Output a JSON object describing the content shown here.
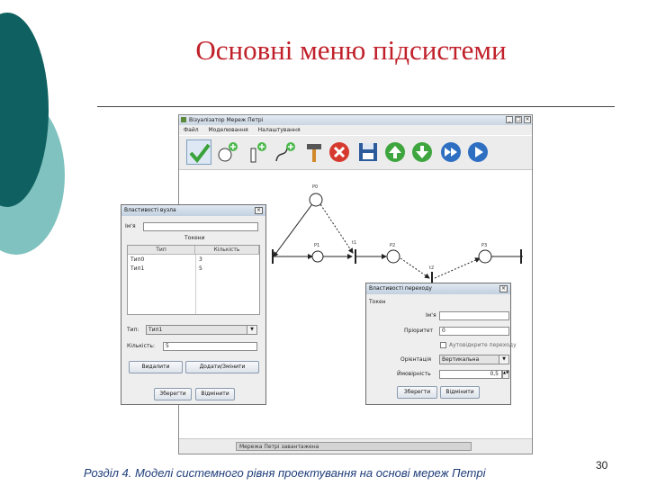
{
  "slide": {
    "title": "Основні меню підсистеми",
    "footer": "Розділ 4. Моделі системного рівня проектування на основі мереж Петрі",
    "page_number": "30",
    "colors": {
      "title": "#c0202a",
      "decor_dark": "#0f6060",
      "decor_light": "#7fc2bf",
      "footer": "#1f3d7a"
    }
  },
  "app": {
    "title": "Візуалізатор Мереж Петрі",
    "menu": [
      "Файл",
      "Моделювання",
      "Налаштування"
    ],
    "toolbar": [
      {
        "name": "select-tool",
        "icon": "checkmark-icon",
        "selected": true
      },
      {
        "name": "add-place",
        "icon": "add-place-icon"
      },
      {
        "name": "add-transition",
        "icon": "add-transition-icon"
      },
      {
        "name": "add-arc",
        "icon": "add-arc-icon"
      },
      {
        "name": "build",
        "icon": "hammer-icon"
      },
      {
        "name": "delete",
        "icon": "delete-icon"
      },
      {
        "name": "save",
        "icon": "floppy-disk-icon"
      },
      {
        "name": "move-up",
        "icon": "arrow-up-icon"
      },
      {
        "name": "move-down",
        "icon": "arrow-down-icon"
      },
      {
        "name": "fast-forward",
        "icon": "fast-forward-icon"
      },
      {
        "name": "play",
        "icon": "play-icon"
      }
    ],
    "net_labels": {
      "place_top": "P0",
      "place_left": "P1",
      "transition_mid": "t1",
      "place_right": "P2",
      "place_far": "P3",
      "transition_bottom": "t2"
    },
    "status": "Мережа Петрі завантажена"
  },
  "node_dialog": {
    "title": "Властивості вузла",
    "name_label": "Ім'я",
    "name_value": "",
    "tokens_header": "Токени",
    "columns": [
      "Тип",
      "Кількість"
    ],
    "rows": [
      {
        "type": "Тип0",
        "count": "3"
      },
      {
        "type": "Тип1",
        "count": "5"
      }
    ],
    "type_label": "Тип:",
    "type_value": "Тип1",
    "count_label": "Кількість:",
    "count_value": "5",
    "remove_button": "Видалити",
    "add_change_button": "Додати/Змінити",
    "save_button": "Зберегти",
    "cancel_button": "Відмінити"
  },
  "transition_dialog": {
    "title": "Властивості переходу",
    "token_label": "Токен",
    "name_label": "Ім'я",
    "name_value": "",
    "priority_label": "Пріоритет",
    "priority_value": "0",
    "checkbox_label": "Аутовідкрите переходу",
    "checkbox_checked": false,
    "orientation_label": "Орієнтація",
    "orientation_value": "Вертикальна",
    "probability_label": "Ймовірність",
    "probability_value": "0,5",
    "save_button": "Зберегти",
    "cancel_button": "Відмінити"
  }
}
